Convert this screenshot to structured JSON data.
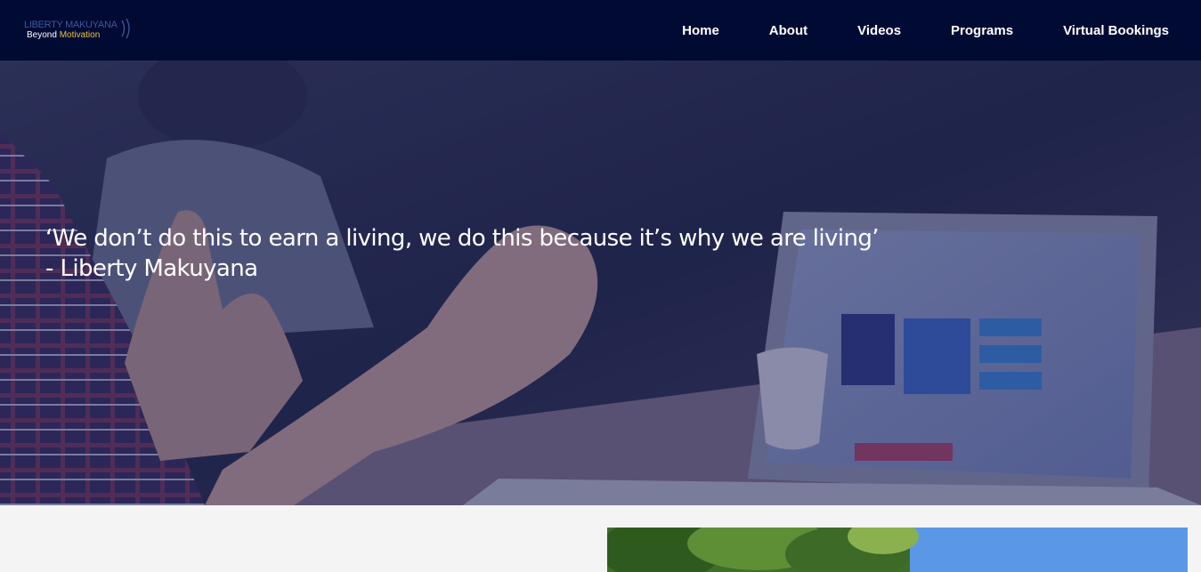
{
  "logo": {
    "name": "LIBERTY MAKUYANA",
    "tagline_prefix": "Beyond",
    "tagline_accent": "Motivation"
  },
  "nav": {
    "items": [
      {
        "label": "Home"
      },
      {
        "label": "About"
      },
      {
        "label": "Videos"
      },
      {
        "label": "Programs"
      },
      {
        "label": "Virtual Bookings"
      }
    ]
  },
  "hero": {
    "quote": "‘We don’t do this to earn a living, we do this because it’s why we are living’",
    "author": "- Liberty Makuyana"
  },
  "colors": {
    "navbar_bg": "#000a33",
    "logo_accent": "#e8c53a",
    "hero_overlay": "#1a1f52",
    "page_bg": "#f4f4f4"
  }
}
